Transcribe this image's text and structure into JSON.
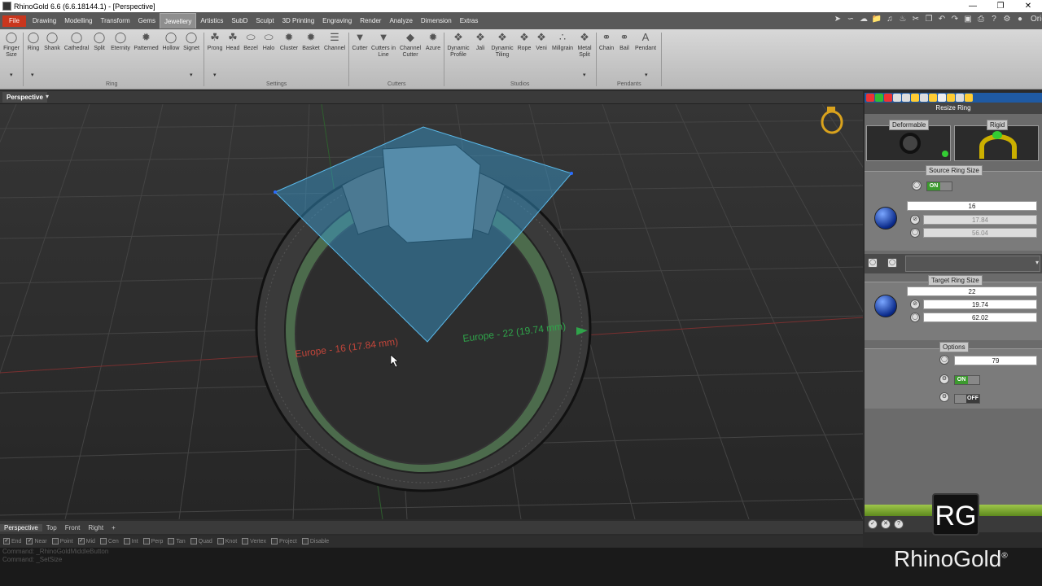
{
  "window": {
    "title": "RhinoGold 6.6 (6.6.18144.1) - [Perspective]"
  },
  "menu": {
    "file": "File",
    "items": [
      "Drawing",
      "Modelling",
      "Transform",
      "Gems",
      "Jewellery",
      "Artistics",
      "SubD",
      "Sculpt",
      "3D Printing",
      "Engraving",
      "Render",
      "Analyze",
      "Dimension",
      "Extras"
    ],
    "active": "Jewellery",
    "user": "Oriol"
  },
  "ribbon": {
    "finger": "Finger Size",
    "ring_buttons": [
      "Ring",
      "Shank",
      "Cathedral",
      "Split",
      "Eternity",
      "Patterned",
      "Hollow",
      "Signet"
    ],
    "settings_buttons": [
      "Prong",
      "Head",
      "Bezel",
      "Halo",
      "Cluster",
      "Basket",
      "Channel"
    ],
    "cutter_buttons": [
      "Cutter",
      "Cutters in Line",
      "Channel Cutter",
      "Azure"
    ],
    "studio_buttons": [
      "Dynamic Profile",
      "Jali",
      "Dynamic Tiling",
      "Rope",
      "Veni",
      "Millgrain",
      "Metal Split"
    ],
    "pendant_buttons": [
      "Chain",
      "Bail",
      "Pendant"
    ],
    "groups": {
      "ring": "Ring",
      "settings": "Settings",
      "cutters": "Cutters",
      "studios": "Studios",
      "pendants": "Pendants"
    }
  },
  "viewport": {
    "name": "Perspective",
    "label_source": "Europe - 16 (17.84 mm)",
    "label_target": "Europe - 22 (19.74 mm)"
  },
  "panel": {
    "title": "Resize Ring",
    "deformable": "Deformable",
    "rigid": "Rigid",
    "source_label": "Source Ring Size",
    "source_on": "ON",
    "source_size": "16",
    "source_diameter": "17.84",
    "source_circ": "56.04",
    "target_label": "Target Ring Size",
    "target_size": "22",
    "target_diameter": "19.74",
    "target_circ": "62.02",
    "options_label": "Options",
    "options_value": "79",
    "opt_toggle1": "ON",
    "opt_toggle2": "OFF"
  },
  "bottom_tabs": [
    "Perspective",
    "Top",
    "Front",
    "Right"
  ],
  "osnaps": [
    {
      "l": "End",
      "c": true
    },
    {
      "l": "Near",
      "c": true
    },
    {
      "l": "Point",
      "c": false
    },
    {
      "l": "Mid",
      "c": true
    },
    {
      "l": "Cen",
      "c": false
    },
    {
      "l": "Int",
      "c": false
    },
    {
      "l": "Perp",
      "c": false
    },
    {
      "l": "Tan",
      "c": false
    },
    {
      "l": "Quad",
      "c": false
    },
    {
      "l": "Knot",
      "c": false
    },
    {
      "l": "Vertex",
      "c": false
    },
    {
      "l": "Project",
      "c": false
    },
    {
      "l": "Disable",
      "c": false
    }
  ],
  "command": {
    "line1": "Command: _RhinoGoldMiddleButton",
    "line2": "Command: _SetSize"
  },
  "brand": {
    "logo": "RhinoGold",
    "reg": "®",
    "badge": "RG"
  }
}
